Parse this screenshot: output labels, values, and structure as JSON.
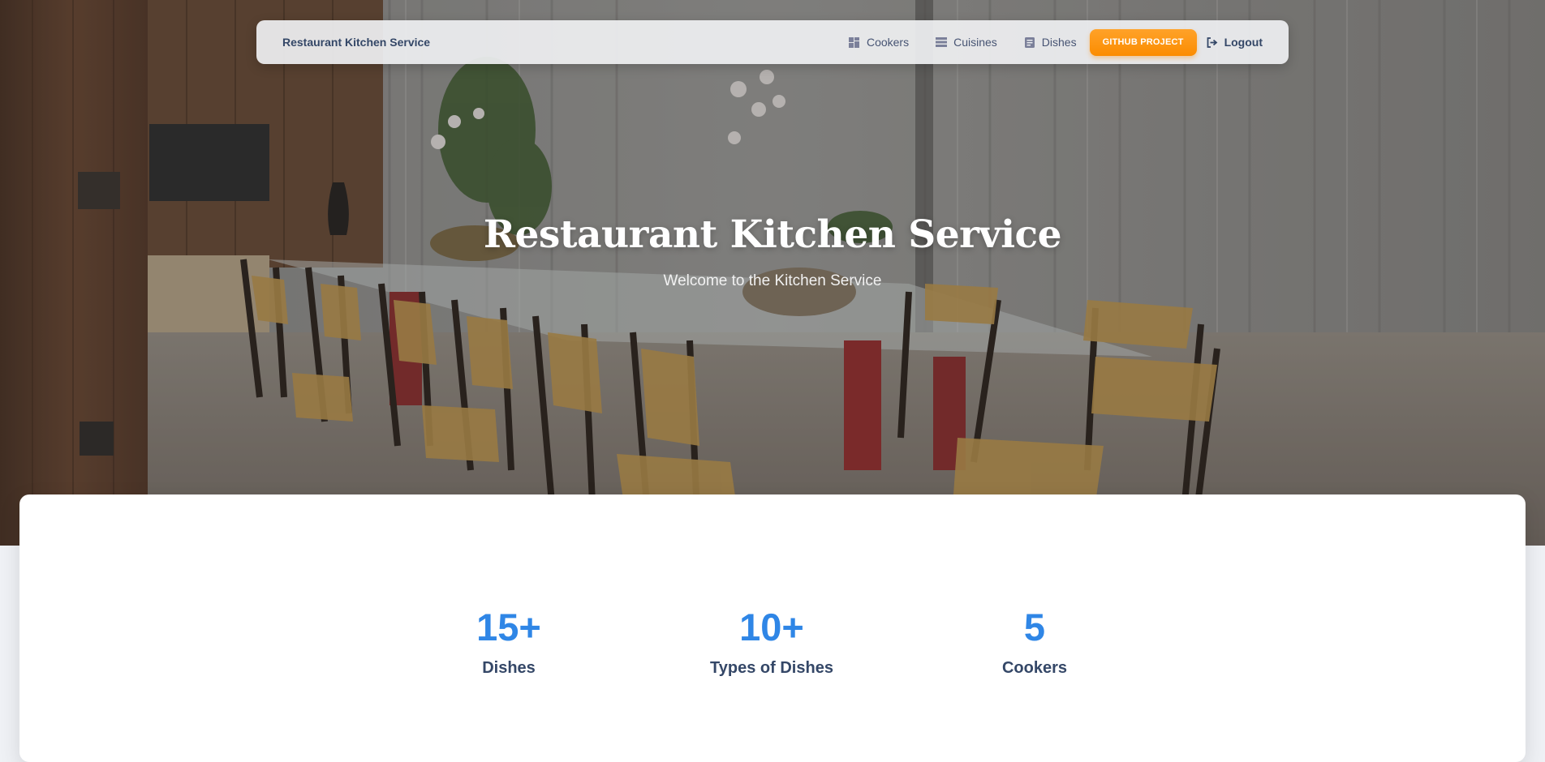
{
  "navbar": {
    "brand": "Restaurant Kitchen Service",
    "links": [
      {
        "label": "Cookers",
        "icon": "dashboard-icon"
      },
      {
        "label": "Cuisines",
        "icon": "table-icon"
      },
      {
        "label": "Dishes",
        "icon": "receipt-icon"
      }
    ],
    "github_label": "GITHUB PROJECT",
    "logout_label": "Logout",
    "logout_icon": "logout-icon"
  },
  "hero": {
    "title": "Restaurant Kitchen Service",
    "subtitle": "Welcome to the Kitchen Service"
  },
  "stats": [
    {
      "value": "15+",
      "label": "Dishes"
    },
    {
      "value": "10+",
      "label": "Types of Dishes"
    },
    {
      "value": "5",
      "label": "Cookers"
    }
  ],
  "colors": {
    "accent_blue": "#2f86e6",
    "button_orange": "#fb8c00",
    "text_dark": "#344767"
  }
}
